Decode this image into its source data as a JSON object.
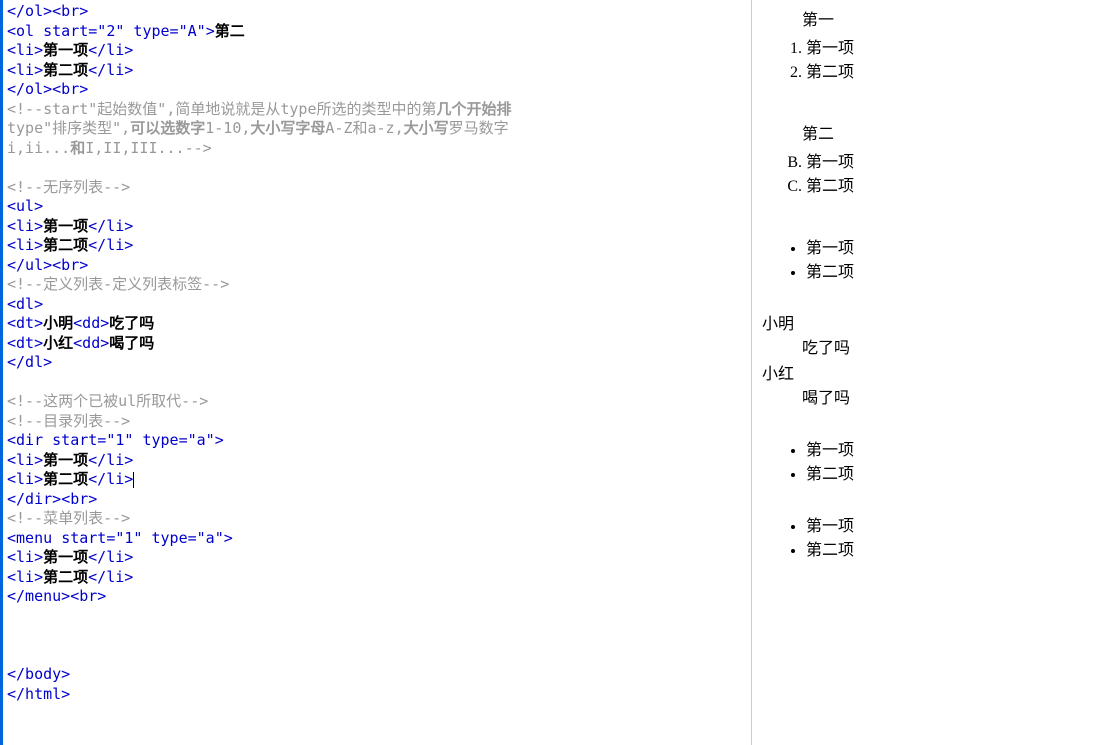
{
  "code": {
    "l1": {
      "tag1": "</ol>",
      "tag2": "<br>"
    },
    "l2": {
      "open": "<ol ",
      "attr": "start=\"2\" type=\"A\"",
      "close": ">",
      "txt": "第二"
    },
    "l3": {
      "open": "<li>",
      "txt": "第一项",
      "close": "</li>"
    },
    "l4": {
      "open": "<li>",
      "txt": "第二项",
      "close": "</li>"
    },
    "l5": {
      "tag1": "</ol>",
      "tag2": "<br>"
    },
    "l6a": "<!--start\"起始数值\",简单地说就是从type所选的类型中的第",
    "l6b": "几个开始排",
    "l7a": "type\"排序类型\",",
    "l7b": "可以选数字",
    "l7c": "1-10,",
    "l7d": "大小写字母",
    "l7e": "A-Z和a-z,",
    "l7f": "大小写",
    "l7g": "罗马数字",
    "l8a": "i,ii...",
    "l8b": "和",
    "l8c": "I,II,III...-->",
    "l9": "<!--无序列表-->",
    "l10": "<ul>",
    "l11": {
      "open": "<li>",
      "txt": "第一项",
      "close": "</li>"
    },
    "l12": {
      "open": "<li>",
      "txt": "第二项",
      "close": "</li>"
    },
    "l13": {
      "tag1": "</ul>",
      "tag2": "<br>"
    },
    "l14": "<!--定义列表-定义列表标签-->",
    "l15": "<dl>",
    "l16": {
      "t1": "<dt>",
      "x1": "小明",
      "t2": "<dd>",
      "x2": "吃了吗"
    },
    "l17": {
      "t1": "<dt>",
      "x1": "小红",
      "t2": "<dd>",
      "x2": "喝了吗"
    },
    "l18": "</dl>",
    "l19": "<!--这两个已被ul所取代-->",
    "l20": "<!--目录列表-->",
    "l21": {
      "open": "<dir ",
      "attr": "start=\"1\" type=\"a\"",
      "close": ">"
    },
    "l22": {
      "open": "<li>",
      "txt": "第一项",
      "close": "</li>"
    },
    "l23": {
      "open": "<li>",
      "txt": "第二项",
      "close": "</li>"
    },
    "l24": {
      "tag1": "</dir>",
      "tag2": "<br>"
    },
    "l25": "<!--菜单列表-->",
    "l26": {
      "open": "<menu ",
      "attr": "start=\"1\" type=\"a\"",
      "close": ">"
    },
    "l27": {
      "open": "<li>",
      "txt": "第一项",
      "close": "</li>"
    },
    "l28": {
      "open": "<li>",
      "txt": "第二项",
      "close": "</li>"
    },
    "l29": {
      "tag1": "</menu>",
      "tag2": "<br>"
    },
    "l30": "</body>",
    "l31": "</html>"
  },
  "preview": {
    "h1": "第一",
    "ol1": [
      "第一项",
      "第二项"
    ],
    "h2": "第二",
    "ol2": [
      "第一项",
      "第二项"
    ],
    "ul1": [
      "第一项",
      "第二项"
    ],
    "dl": [
      {
        "dt": "小明",
        "dd": "吃了吗"
      },
      {
        "dt": "小红",
        "dd": "喝了吗"
      }
    ],
    "dir": [
      "第一项",
      "第二项"
    ],
    "menu": [
      "第一项",
      "第二项"
    ]
  }
}
